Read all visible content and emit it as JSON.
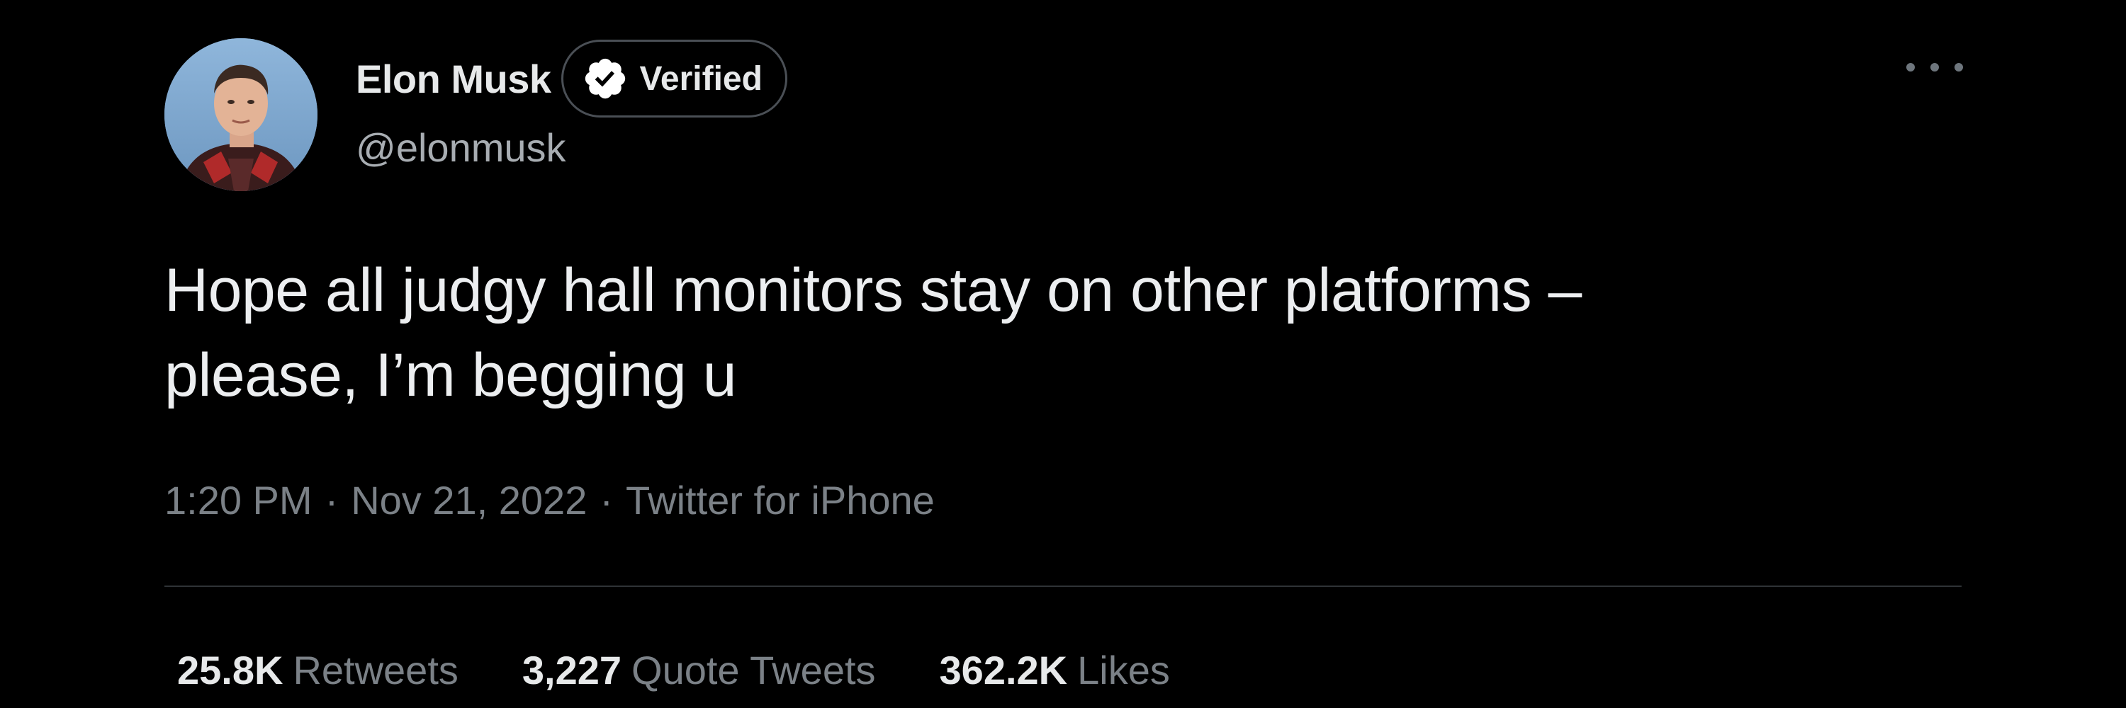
{
  "author": {
    "display_name": "Elon Musk",
    "verified_label": "Verified",
    "handle": "@elonmusk",
    "avatar_icon": "profile-photo"
  },
  "tweet": {
    "text_lines": [
      "Hope all judgy hall monitors stay on other platforms –",
      "please, I’m begging u"
    ],
    "time": "1:20 PM",
    "date": "Nov 21, 2022",
    "separator": "·",
    "source": "Twitter for iPhone"
  },
  "stats": {
    "retweets": {
      "value": "25.8K",
      "label": "Retweets"
    },
    "quote_tweets": {
      "value": "3,227",
      "label": "Quote Tweets"
    },
    "likes": {
      "value": "362.2K",
      "label": "Likes"
    }
  },
  "icons": {
    "more": "more-horizontal-icon",
    "verified": "verified-badge-icon"
  },
  "colors": {
    "background": "#000000",
    "primary_text": "#e7e9ea",
    "secondary_text": "#7b8187",
    "divider": "#2f3336"
  }
}
